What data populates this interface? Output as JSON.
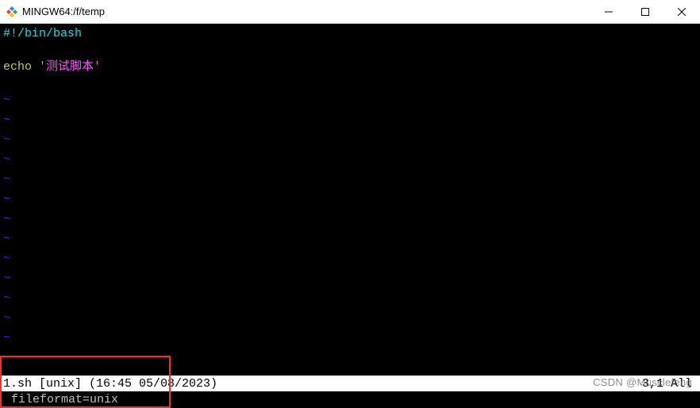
{
  "titlebar": {
    "title": "MINGW64:/f/temp"
  },
  "editor": {
    "line1": "#!/bin/bash",
    "echo_keyword": "echo",
    "echo_string": " '测试脚本'",
    "tilde": "~"
  },
  "status": {
    "left": "1.sh [unix] (16:45 05/08/2023)",
    "right": "3,1 All"
  },
  "cmd": {
    "text": "fileformat=unix"
  },
  "watermark": "CSDN @Musclefeng"
}
